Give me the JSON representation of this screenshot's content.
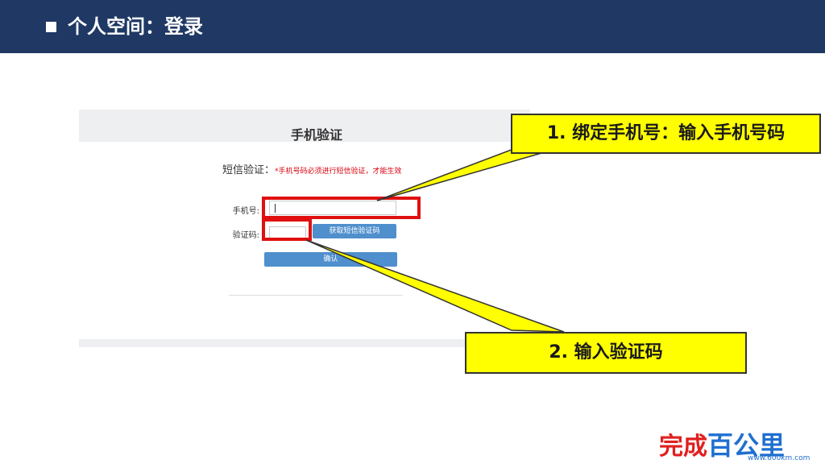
{
  "header": {
    "title": "个人空间：登录"
  },
  "login_panel": {
    "title": "手机验证",
    "sms_label": "短信验证：",
    "sms_note": "*手机号码必须进行短信验证，才能生效",
    "phone_label": "手机号:",
    "phone_value": "",
    "code_label": "验证码:",
    "code_value": "",
    "get_code_button": "获取短信验证码",
    "confirm_button": "确认"
  },
  "callouts": {
    "step1": "1. 绑定手机号：输入手机号码",
    "step2": "2. 输入验证码"
  },
  "watermark": {
    "text_main": "完成",
    "text_accent": "百公里",
    "text_small": "www.600km.com"
  },
  "colors": {
    "header_bg": "#1f3864",
    "highlight_red": "#e01010",
    "callout_yellow": "#ffff00",
    "button_blue": "#4f8fcd"
  }
}
